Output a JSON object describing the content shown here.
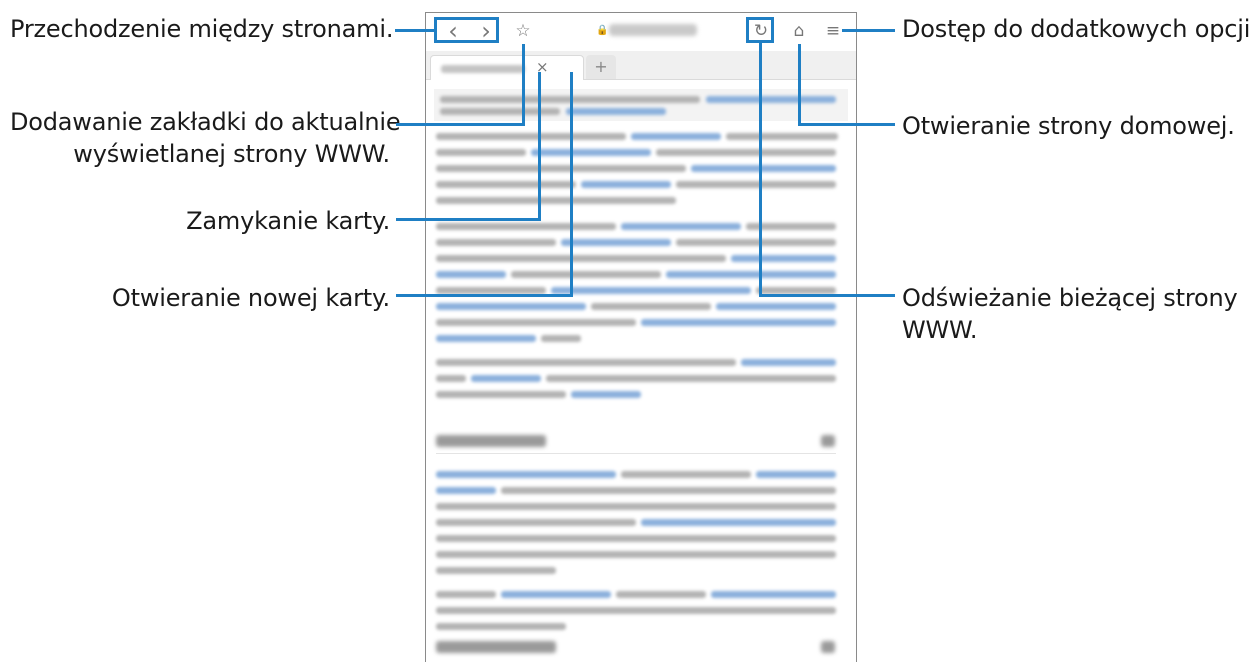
{
  "labels": {
    "navigation": "Przechodzenie między stronami.",
    "bookmark_line1": "Dodawanie zakładki do aktualnie",
    "bookmark_line2": "wyświetlanej strony WWW.",
    "close_tab": "Zamykanie karty.",
    "new_tab": "Otwieranie nowej karty.",
    "more_options": "Dostęp do dodatkowych opcji.",
    "home": "Otwieranie strony domowej.",
    "refresh_line1": "Odświeżanie bieżącej strony",
    "refresh_line2": "WWW."
  },
  "browser": {
    "back_icon": "‹",
    "forward_icon": "›",
    "bookmark_icon": "☆",
    "lock_icon": "🔒",
    "refresh_icon": "↻",
    "home_icon": "⌂",
    "menu_icon": "≡",
    "tab_close_icon": "×",
    "new_tab_icon": "+"
  },
  "colors": {
    "callout": "#1f7fc4"
  }
}
